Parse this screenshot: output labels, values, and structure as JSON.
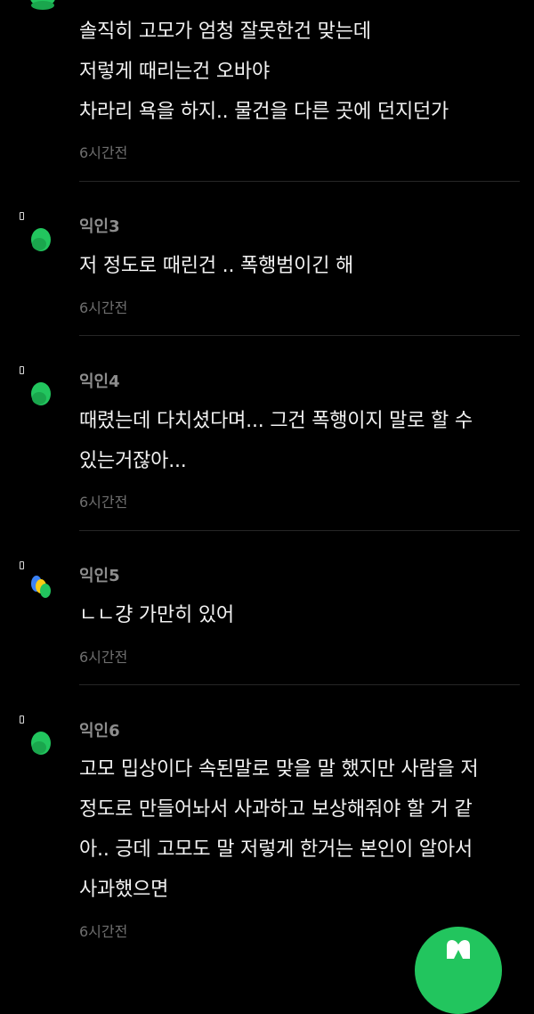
{
  "comments": [
    {
      "nickname": "",
      "lines": [
        "솔직히 고모가 엄청 잘못한건 맞는데",
        "저렇게 때리는건 오바야",
        "차라리 욕을 하지.. 물건을 다른 곳에 던지던가"
      ],
      "time": "6시간전"
    },
    {
      "nickname": "익인3",
      "lines": [
        "저 정도로 때린건 .. 폭행범이긴 해"
      ],
      "time": "6시간전"
    },
    {
      "nickname": "익인4",
      "lines": [
        "때렸는데 다치셨다며... 그건 폭행이지 말로 할 수",
        "있는거잖아..."
      ],
      "time": "6시간전"
    },
    {
      "nickname": "익인5",
      "lines": [
        "ㄴㄴ걍 가만히 있어"
      ],
      "time": "6시간전"
    },
    {
      "nickname": "익인6",
      "lines": [
        "고모 밉상이다 속된말로 맞을 말 했지만 사람을 저",
        "정도로 만들어놔서 사과하고 보상해줘야 할 거 같",
        "아.. 긍데 고모도 말 저렇게 한거는 본인이 알아서",
        "사과했으면"
      ],
      "time": "6시간전"
    }
  ],
  "colors": {
    "background": "#000000",
    "text": "#f2f2f2",
    "nickname": "#8d8d8d",
    "timestamp": "#6e6e6e",
    "avatar_green": "#22c55e",
    "fab_green": "#22c55e"
  },
  "icons": {
    "avatar": "green-blob-avatar-icon",
    "pin": "pin-icon",
    "fab": "write-icon"
  }
}
